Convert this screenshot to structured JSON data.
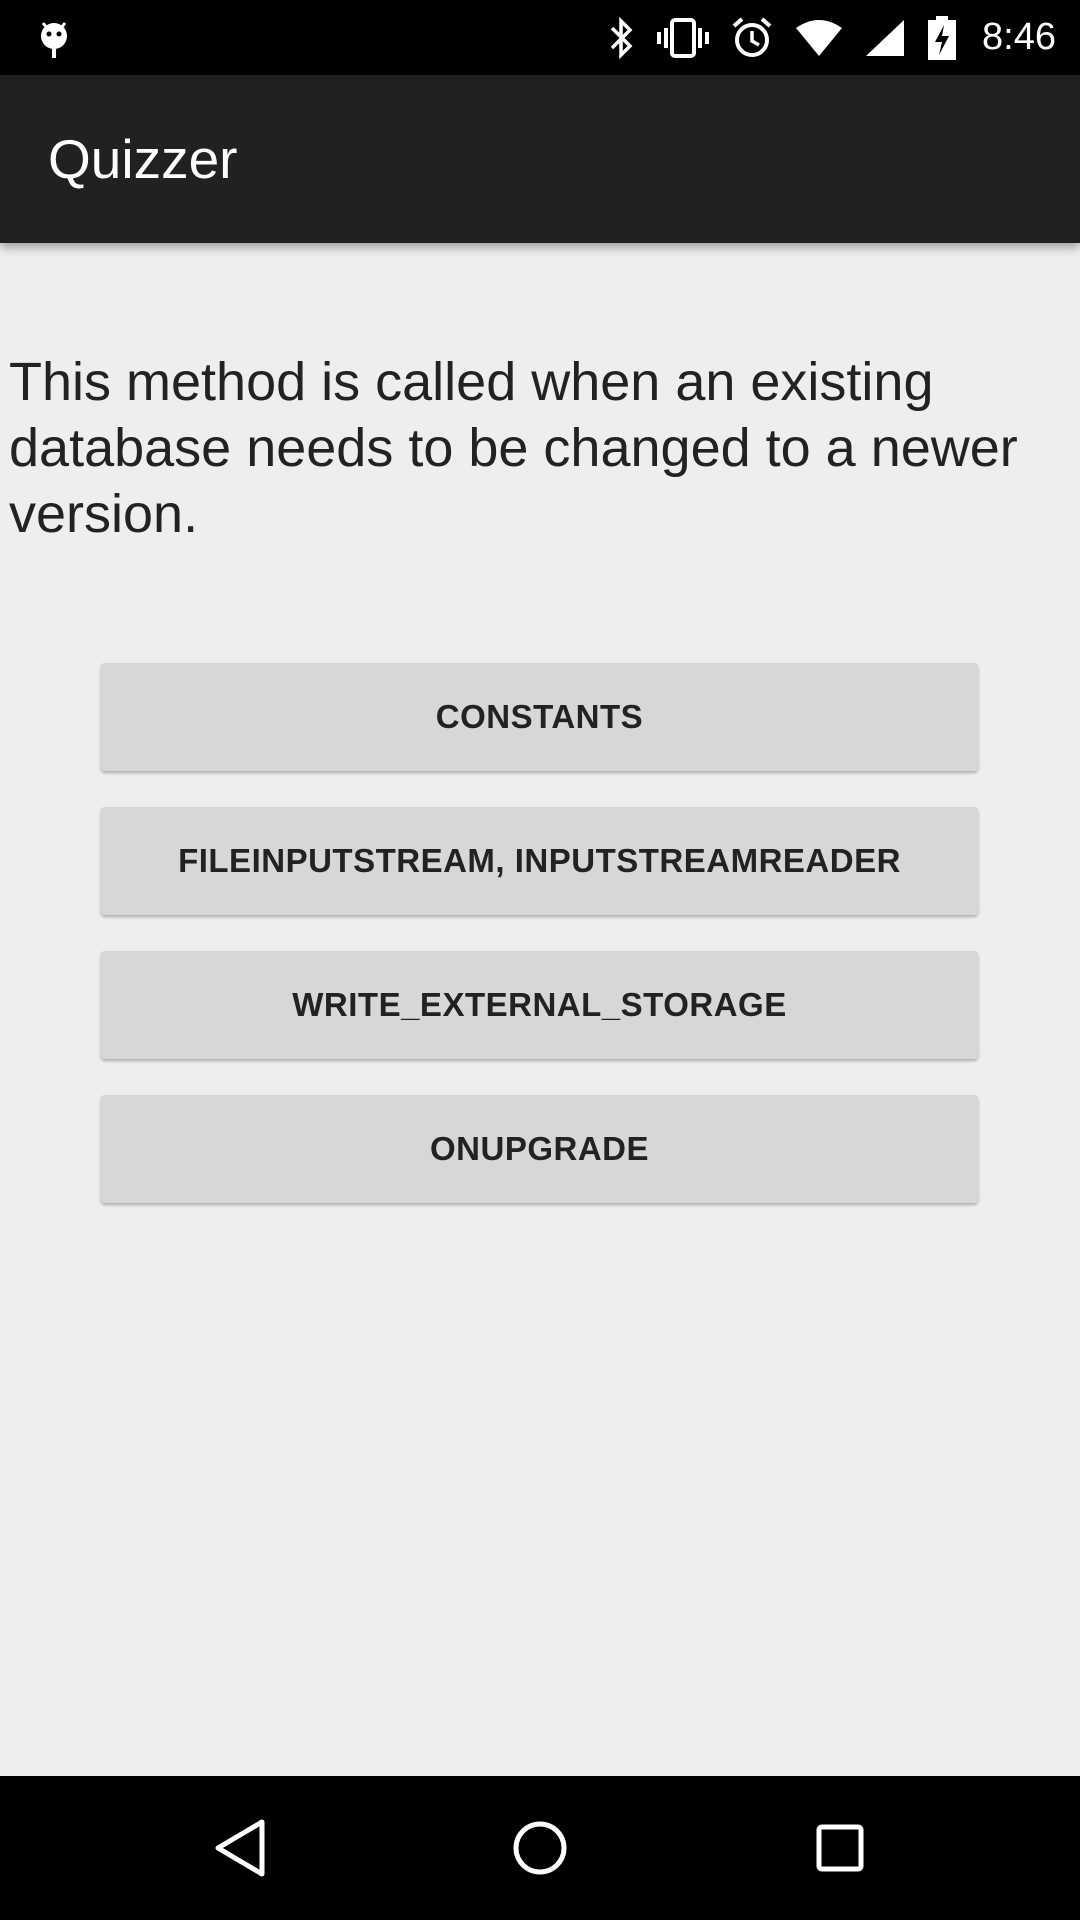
{
  "status_bar": {
    "time": "8:46",
    "icons": [
      "android-debug-icon",
      "bluetooth-icon",
      "vibrate-icon",
      "alarm-icon",
      "wifi-icon",
      "cell-signal-icon",
      "battery-charging-icon"
    ]
  },
  "app_bar": {
    "title": "Quizzer"
  },
  "question": {
    "text": "This method is called when an existing database needs to be changed to a newer version."
  },
  "answers": [
    {
      "label": "CONSTANTS"
    },
    {
      "label": "FILEINPUTSTREAM, INPUTSTREAMREADER"
    },
    {
      "label": "WRITE_EXTERNAL_STORAGE"
    },
    {
      "label": "ONUPGRADE"
    }
  ],
  "nav_bar": {
    "icons": [
      "back-icon",
      "home-icon",
      "recents-icon"
    ]
  },
  "colors": {
    "status_bar": "#000000",
    "app_bar": "#212121",
    "background": "#eeeeee",
    "button": "#d6d7d7",
    "text": "#222222"
  }
}
